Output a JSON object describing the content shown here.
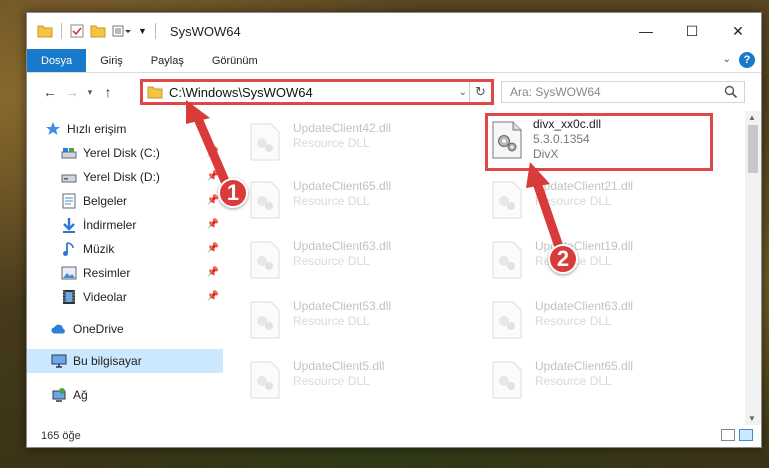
{
  "window": {
    "title": "SysWOW64",
    "minimize": "—",
    "maximize": "☐",
    "close": "✕"
  },
  "ribbon": {
    "tabs": [
      "Dosya",
      "Giriş",
      "Paylaş",
      "Görünüm"
    ],
    "help": "?"
  },
  "nav": {
    "address": "C:\\Windows\\SysWOW64",
    "search_placeholder": "Ara: SysWOW64"
  },
  "sidebar": {
    "items": [
      {
        "label": "Hızlı erişim",
        "icon": "star-icon"
      },
      {
        "label": "Yerel Disk (C:)",
        "icon": "drive-icon",
        "pinned": true
      },
      {
        "label": "Yerel Disk (D:)",
        "icon": "drive-icon",
        "pinned": true
      },
      {
        "label": "Belgeler",
        "icon": "documents-icon",
        "pinned": true
      },
      {
        "label": "İndirmeler",
        "icon": "download-icon",
        "pinned": true
      },
      {
        "label": "Müzik",
        "icon": "music-icon",
        "pinned": true
      },
      {
        "label": "Resimler",
        "icon": "pictures-icon",
        "pinned": true
      },
      {
        "label": "Videolar",
        "icon": "videos-icon",
        "pinned": true
      },
      {
        "label": "OneDrive",
        "icon": "cloud-icon"
      },
      {
        "label": "Bu bilgisayar",
        "icon": "computer-icon",
        "selected": true
      },
      {
        "label": "Ağ",
        "icon": "network-icon"
      }
    ]
  },
  "files": {
    "left": [
      {
        "name": "UpdateClient42.dll",
        "sub": "Resource DLL"
      },
      {
        "name": "UpdateClient65.dll",
        "sub": "Resource DLL"
      },
      {
        "name": "UpdateClient63.dll",
        "sub": "Resource DLL"
      },
      {
        "name": "UpdateClient53.dll",
        "sub": "Resource DLL"
      },
      {
        "name": "UpdateClient5.dll",
        "sub": "Resource DLL"
      }
    ],
    "right": [
      {
        "name": "UpdateClient21.dll",
        "sub": "Resource DLL"
      },
      {
        "name": "UpdateClient19.dll",
        "sub": "Resource DLL"
      },
      {
        "name": "UpdateClient63.dll",
        "sub": "Resource DLL"
      },
      {
        "name": "UpdateClient65.dll",
        "sub": "Resource DLL"
      }
    ],
    "highlighted": {
      "name": "divx_xx0c.dll",
      "version": "5.3.0.1354",
      "company": "DivX"
    }
  },
  "status": {
    "count": "165 öğe"
  },
  "callouts": {
    "one": "1",
    "two": "2"
  },
  "colors": {
    "accent": "#1979ca",
    "annotation": "#e04848"
  }
}
